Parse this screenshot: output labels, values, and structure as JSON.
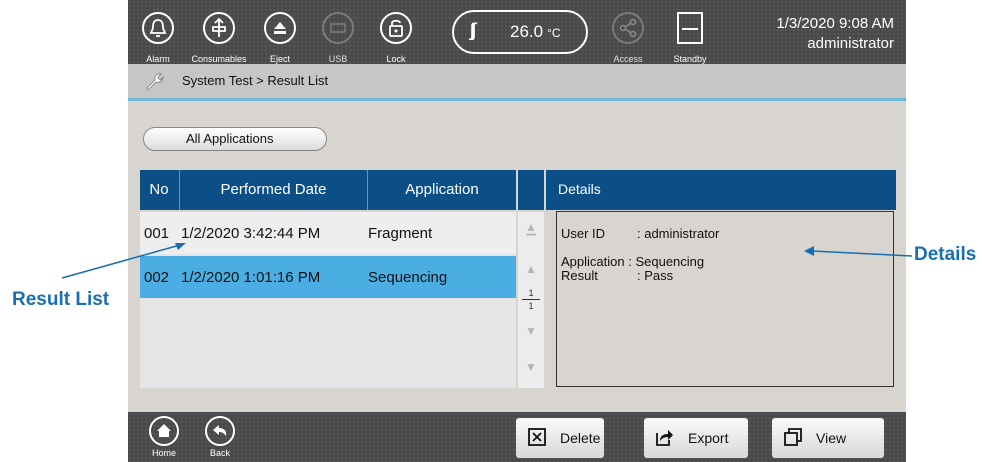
{
  "topbar": {
    "buttons": [
      {
        "label": "Alarm",
        "icon": "bell-icon"
      },
      {
        "label": "Consumables",
        "icon": "consumables-icon"
      },
      {
        "label": "Eject",
        "icon": "eject-icon"
      },
      {
        "label": "USB",
        "icon": "usb-icon"
      },
      {
        "label": "Lock",
        "icon": "lock-icon"
      }
    ],
    "temperature": {
      "value": "26.0",
      "unit": "°C",
      "icon": "heater-icon"
    },
    "access": {
      "label": "Access",
      "icon": "share-icon"
    },
    "standby": {
      "label": "Standby",
      "icon": "standby-icon"
    },
    "datetime": "1/3/2020 9:08 AM",
    "user": "administrator"
  },
  "breadcrumb": "System Test > Result List",
  "filter": {
    "label": "All Applications"
  },
  "table": {
    "columns": [
      "No",
      "Performed Date",
      "Application"
    ],
    "rows": [
      {
        "no": "001",
        "date": "1/2/2020 3:42:44 PM",
        "application": "Fragment",
        "selected": false
      },
      {
        "no": "002",
        "date": "1/2/2020 1:01:16 PM",
        "application": "Sequencing",
        "selected": true
      }
    ]
  },
  "pager": {
    "current": "1",
    "total": "1"
  },
  "details": {
    "header": "Details",
    "fields": [
      {
        "label": "User ID",
        "value": ": administrator"
      },
      {
        "label": "Application",
        "value": ": Sequencing"
      },
      {
        "label": "Result",
        "value": ": Pass"
      }
    ]
  },
  "bottombar": {
    "home": "Home",
    "back": "Back",
    "delete": "Delete",
    "export": "Export",
    "view": "View"
  },
  "callouts": {
    "result_list": "Result List",
    "details": "Details"
  },
  "colors": {
    "header_blue": "#0b4f86",
    "selected_row": "#4aaee3",
    "callout": "#1a6fb0"
  }
}
